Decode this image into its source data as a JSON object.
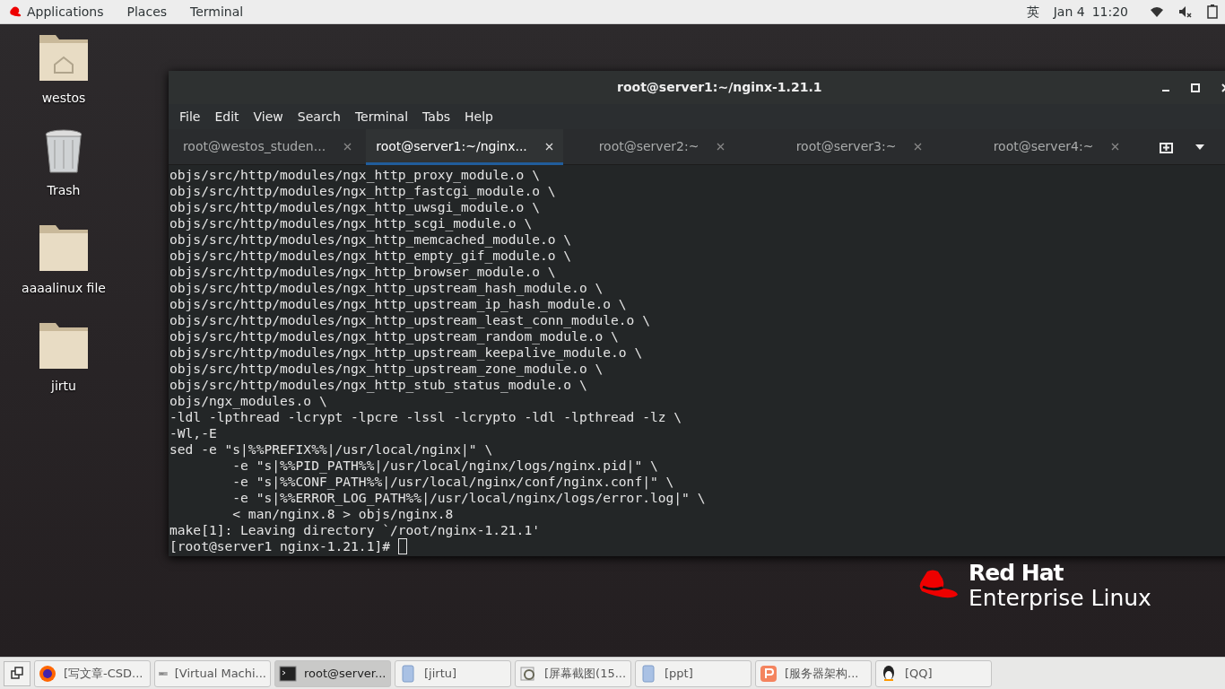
{
  "top_bar": {
    "menus": [
      "Applications",
      "Places",
      "Terminal"
    ],
    "input_method": "英",
    "date": "Jan 4",
    "time": "11:20"
  },
  "desktop_icons": [
    {
      "label": "westos",
      "kind": "home"
    },
    {
      "label": "Trash",
      "kind": "trash"
    },
    {
      "label": "aaaalinux file",
      "kind": "folder"
    },
    {
      "label": "jirtu",
      "kind": "folder"
    }
  ],
  "terminal": {
    "title": "root@server1:~/nginx-1.21.1",
    "menu": [
      "File",
      "Edit",
      "View",
      "Search",
      "Terminal",
      "Tabs",
      "Help"
    ],
    "tabs": [
      {
        "label": "root@westos_studen...",
        "selected": false
      },
      {
        "label": "root@server1:~/nginx...",
        "selected": true
      },
      {
        "label": "root@server2:~",
        "selected": false
      },
      {
        "label": "root@server3:~",
        "selected": false
      },
      {
        "label": "root@server4:~",
        "selected": false
      }
    ],
    "lines": [
      "objs/src/http/modules/ngx_http_proxy_module.o \\",
      "objs/src/http/modules/ngx_http_fastcgi_module.o \\",
      "objs/src/http/modules/ngx_http_uwsgi_module.o \\",
      "objs/src/http/modules/ngx_http_scgi_module.o \\",
      "objs/src/http/modules/ngx_http_memcached_module.o \\",
      "objs/src/http/modules/ngx_http_empty_gif_module.o \\",
      "objs/src/http/modules/ngx_http_browser_module.o \\",
      "objs/src/http/modules/ngx_http_upstream_hash_module.o \\",
      "objs/src/http/modules/ngx_http_upstream_ip_hash_module.o \\",
      "objs/src/http/modules/ngx_http_upstream_least_conn_module.o \\",
      "objs/src/http/modules/ngx_http_upstream_random_module.o \\",
      "objs/src/http/modules/ngx_http_upstream_keepalive_module.o \\",
      "objs/src/http/modules/ngx_http_upstream_zone_module.o \\",
      "objs/src/http/modules/ngx_http_stub_status_module.o \\",
      "objs/ngx_modules.o \\",
      "-ldl -lpthread -lcrypt -lpcre -lssl -lcrypto -ldl -lpthread -lz \\",
      "-Wl,-E",
      "sed -e \"s|%%PREFIX%%|/usr/local/nginx|\" \\",
      "        -e \"s|%%PID_PATH%%|/usr/local/nginx/logs/nginx.pid|\" \\",
      "        -e \"s|%%CONF_PATH%%|/usr/local/nginx/conf/nginx.conf|\" \\",
      "        -e \"s|%%ERROR_LOG_PATH%%|/usr/local/nginx/logs/error.log|\" \\",
      "        < man/nginx.8 > objs/nginx.8",
      "make[1]: Leaving directory `/root/nginx-1.21.1'"
    ],
    "prompt": "[root@server1 nginx-1.21.1]# "
  },
  "logo": {
    "line1": "Red Hat",
    "line2": "Enterprise Linux"
  },
  "taskbar": [
    {
      "label": "[写文章-CSD...",
      "kind": "browser",
      "selected": false
    },
    {
      "label": "[Virtual Machi...",
      "kind": "vm",
      "selected": false
    },
    {
      "label": "root@server...",
      "kind": "terminal",
      "selected": true
    },
    {
      "label": "[jirtu]",
      "kind": "files",
      "selected": false
    },
    {
      "label": "[屏幕截图(15...",
      "kind": "viewer",
      "selected": false
    },
    {
      "label": "[ppt]",
      "kind": "files",
      "selected": false
    },
    {
      "label": "[服务器架构...",
      "kind": "slides",
      "selected": false
    },
    {
      "label": "[QQ]",
      "kind": "qq",
      "selected": false
    }
  ]
}
